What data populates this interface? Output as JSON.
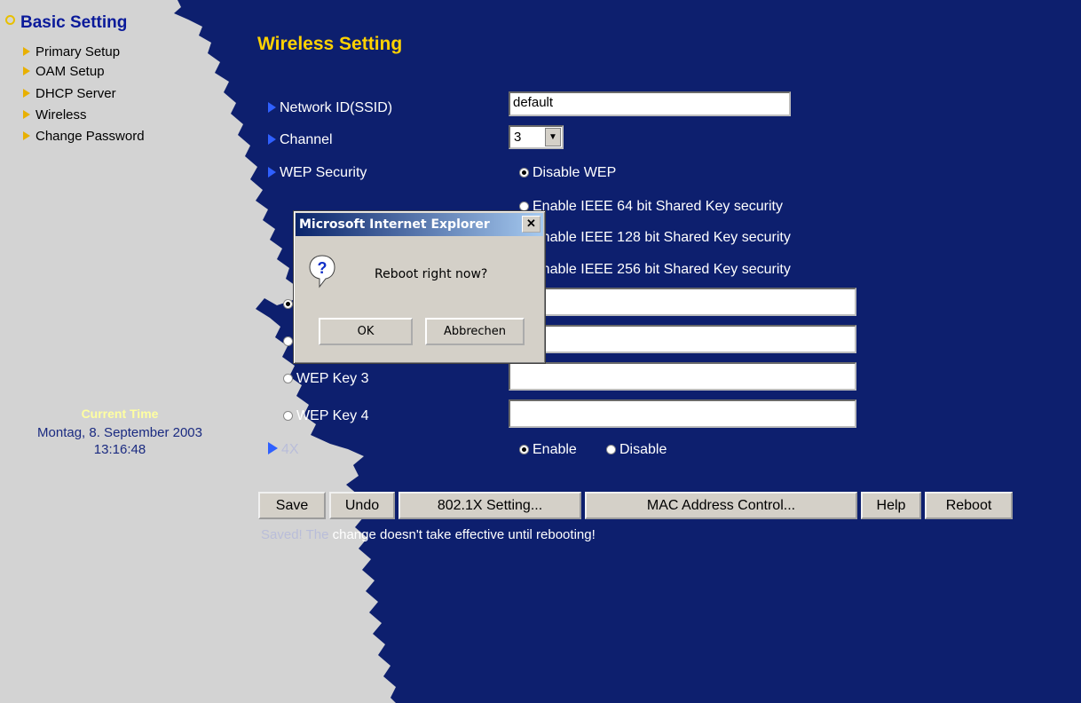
{
  "sidebar": {
    "title": "Basic Setting",
    "items": [
      "Primary Setup",
      "OAM Setup",
      "DHCP Server",
      "Wireless",
      "Change Password"
    ],
    "time_label": "Current Time",
    "time_date": "Montag, 8. September 2003",
    "time_clock": "13:16:48"
  },
  "main": {
    "title": "Wireless Setting",
    "ssid_label": "Network ID(SSID)",
    "ssid_value": "default",
    "channel_label": "Channel",
    "channel_value": "3",
    "wep_label": "WEP Security",
    "wep_options": [
      "Disable WEP",
      "Enable IEEE 64 bit Shared Key security",
      "Enable IEEE 128 bit Shared Key security",
      "Enable IEEE 256 bit Shared Key security"
    ],
    "wep_selected": "Disable WEP",
    "wep_key3_label": "WEP Key 3",
    "wep_key4_label": "WEP Key 4",
    "x4_label": "4X",
    "x4_enable": "Enable",
    "x4_disable": "Disable",
    "x4_selected": "Enable"
  },
  "buttons": {
    "save": "Save",
    "undo": "Undo",
    "dot1x": "802.1X Setting...",
    "mac": "MAC Address Control...",
    "help": "Help",
    "reboot": "Reboot"
  },
  "status": {
    "faded": "Saved! The ",
    "text": "change doesn't take effective until rebooting!"
  },
  "dialog": {
    "title": "Microsoft Internet Explorer",
    "close_glyph": "✕",
    "message": "Reboot right now?",
    "ok": "OK",
    "cancel": "Abbrechen"
  },
  "colors": {
    "background": "#0d1f6e",
    "sidebar": "#d3d3d3",
    "title": "#ffd200",
    "bullet_blue": "#2f60ff",
    "bullet_orange": "#e8b000",
    "dialog_titlebar": "#0a246a"
  }
}
